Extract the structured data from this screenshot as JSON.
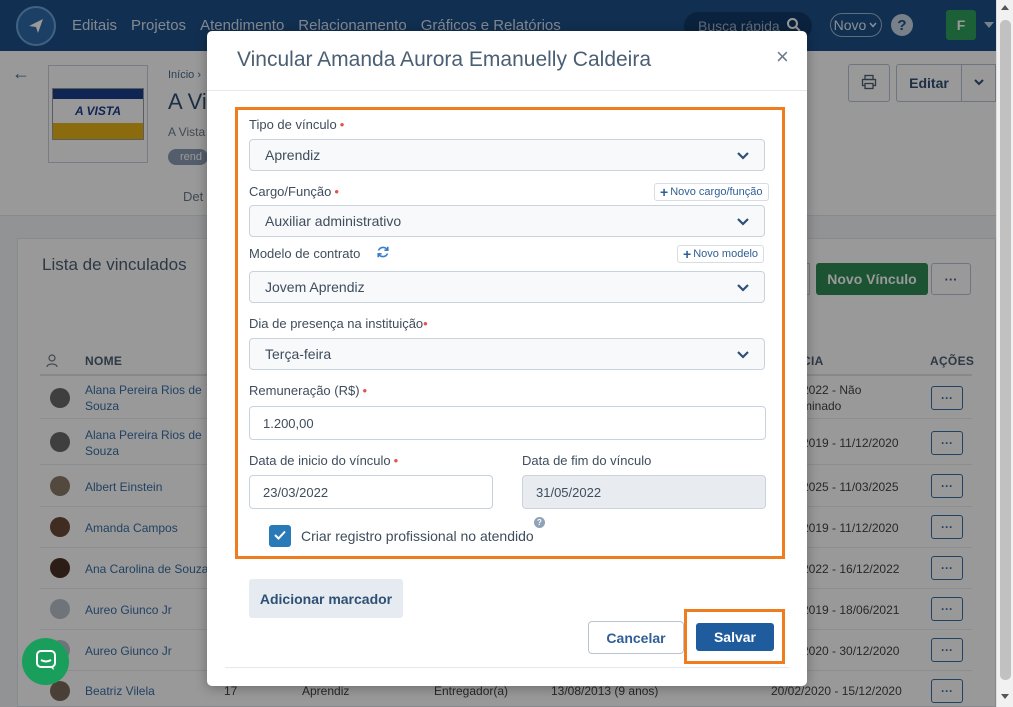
{
  "topbar": {
    "nav": [
      "Editais",
      "Projetos",
      "Atendimento",
      "Relacionamento",
      "Gráficos e Relatórios"
    ],
    "search_placeholder": "Busca rápida",
    "novo_label": "Novo",
    "help_label": "?",
    "avatar_initial": "F"
  },
  "page": {
    "breadcrumb": "Início",
    "title": "A Vi",
    "subtitle": "A Vista",
    "tag": "rend",
    "tab": "Det",
    "card_text": "A VISTA",
    "edit_label": "Editar"
  },
  "list": {
    "title": "Lista de vinculados",
    "new_button": "Novo Vínculo",
    "more": "···",
    "headers": {
      "name": "NOME",
      "validity": "CIA",
      "actions": "AÇÕES"
    },
    "rows": [
      {
        "name": "Alana Pereira Rios de Souza",
        "dates": "2022 - Não\nminado"
      },
      {
        "name": "Alana Pereira Rios de Souza",
        "dates": "2019 - 11/12/2020"
      },
      {
        "name": "Albert Einstein",
        "dates": "2025 - 11/03/2025"
      },
      {
        "name": "Amanda Campos",
        "dates": "2019 - 11/12/2020"
      },
      {
        "name": "Ana Carolina de Souza",
        "dates": "2022 - 16/12/2022"
      },
      {
        "name": "Aureo Giunco Jr",
        "dates": "2019 - 18/06/2021"
      },
      {
        "name": "Aureo Giunco Jr",
        "dates": "2020 - 30/12/2020"
      }
    ],
    "last_row": {
      "name": "Beatriz Vilela",
      "number": "17",
      "type": "Aprendiz",
      "role": "Entregador(a)",
      "start": "13/08/2013 (9 anos)",
      "range": "20/02/2020 - 15/12/2020"
    }
  },
  "modal": {
    "title": "Vincular Amanda Aurora Emanuelly Caldeira",
    "close": "×",
    "fields": {
      "tipo_label": "Tipo de vínculo",
      "tipo_value": "Aprendiz",
      "cargo_label": "Cargo/Função",
      "cargo_value": "Auxiliar administrativo",
      "novo_cargo": "Novo cargo/função",
      "modelo_label": "Modelo de contrato",
      "modelo_value": "Jovem Aprendiz",
      "novo_modelo": "Novo modelo",
      "dia_label": "Dia de presença na instituição",
      "dia_value": "Terça-feira",
      "remuneracao_label": "Remuneração (R$)",
      "remuneracao_value": "1.200,00",
      "inicio_label": "Data de inicio do vínculo",
      "inicio_value": "23/03/2022",
      "fim_label": "Data de fim do vínculo",
      "fim_value": "31/05/2022",
      "checkbox_label": "Criar registro profissional no atendido",
      "checkbox_checked": true
    },
    "marcador_button": "Adicionar marcador",
    "cancel_button": "Cancelar",
    "save_button": "Salvar"
  },
  "colors": {
    "accent": "#f07d1d",
    "primary": "#1f5c9e",
    "topbar": "#1d4f87",
    "success": "#2d8b55"
  }
}
